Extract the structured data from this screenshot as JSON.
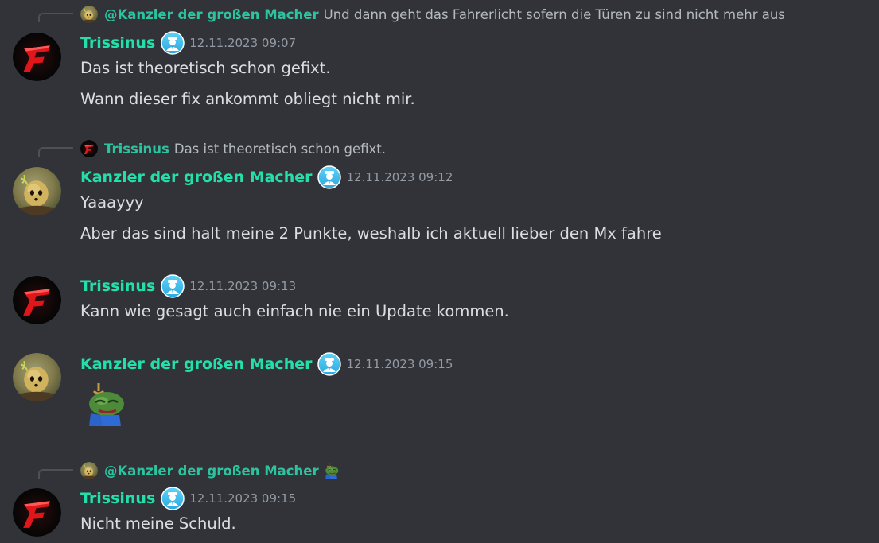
{
  "colors": {
    "background": "#313338",
    "username": "#23e0aa",
    "reply_username": "#2cc49f",
    "message_text": "#dbdee1",
    "timestamp": "#949ba4",
    "reply_text": "#b5bac1"
  },
  "messages": [
    {
      "reply": {
        "author": "@Kanzler der großen Macher",
        "text": "Und dann geht das Fahrerlicht sofern die Türen zu sind nicht mehr aus",
        "avatar": "potato-avatar"
      },
      "author": "Trissinus",
      "avatar": "red-f-logo-avatar",
      "badge": "role-badge-icon",
      "timestamp": "12.11.2023 09:07",
      "lines": [
        "Das ist theoretisch schon gefixt.",
        "Wann dieser fix ankommt obliegt nicht mir."
      ]
    },
    {
      "reply": {
        "author": "Trissinus",
        "text": "Das ist theoretisch schon gefixt.",
        "avatar": "red-f-logo-avatar"
      },
      "author": "Kanzler der großen Macher",
      "avatar": "potato-avatar",
      "badge": "role-badge-icon",
      "timestamp": "12.11.2023 09:12",
      "lines": [
        "Yaaayyy",
        "Aber das sind halt meine 2 Punkte, weshalb ich aktuell lieber den Mx fahre"
      ]
    },
    {
      "author": "Trissinus",
      "avatar": "red-f-logo-avatar",
      "badge": "role-badge-icon",
      "timestamp": "12.11.2023 09:13",
      "lines": [
        "Kann wie gesagt auch einfach nie ein Update kommen."
      ]
    },
    {
      "author": "Kanzler der großen Macher",
      "avatar": "potato-avatar",
      "badge": "role-badge-icon",
      "timestamp": "12.11.2023 09:15",
      "emoji": "pepe-hanging-emoji"
    },
    {
      "reply": {
        "author": "@Kanzler der großen Macher",
        "text": "",
        "avatar": "potato-avatar",
        "emoji": "pepe-hanging-emoji"
      },
      "author": "Trissinus",
      "avatar": "red-f-logo-avatar",
      "badge": "role-badge-icon",
      "timestamp": "12.11.2023 09:15",
      "lines": [
        "Nicht meine Schuld."
      ]
    }
  ]
}
